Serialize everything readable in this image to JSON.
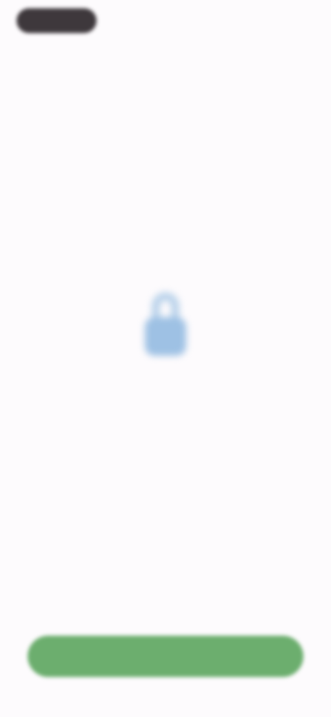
{
  "status_bar": {
    "indicator_icon": "status-pill"
  },
  "content": {
    "icon": "lock-icon",
    "title": "",
    "subtitle": ""
  },
  "footer": {
    "button_label": ""
  },
  "colors": {
    "background": "#fdfbfd",
    "accent_green": "#6cae6e",
    "icon_blue": "#9ec1e4",
    "pill_dark": "#3e383c"
  }
}
